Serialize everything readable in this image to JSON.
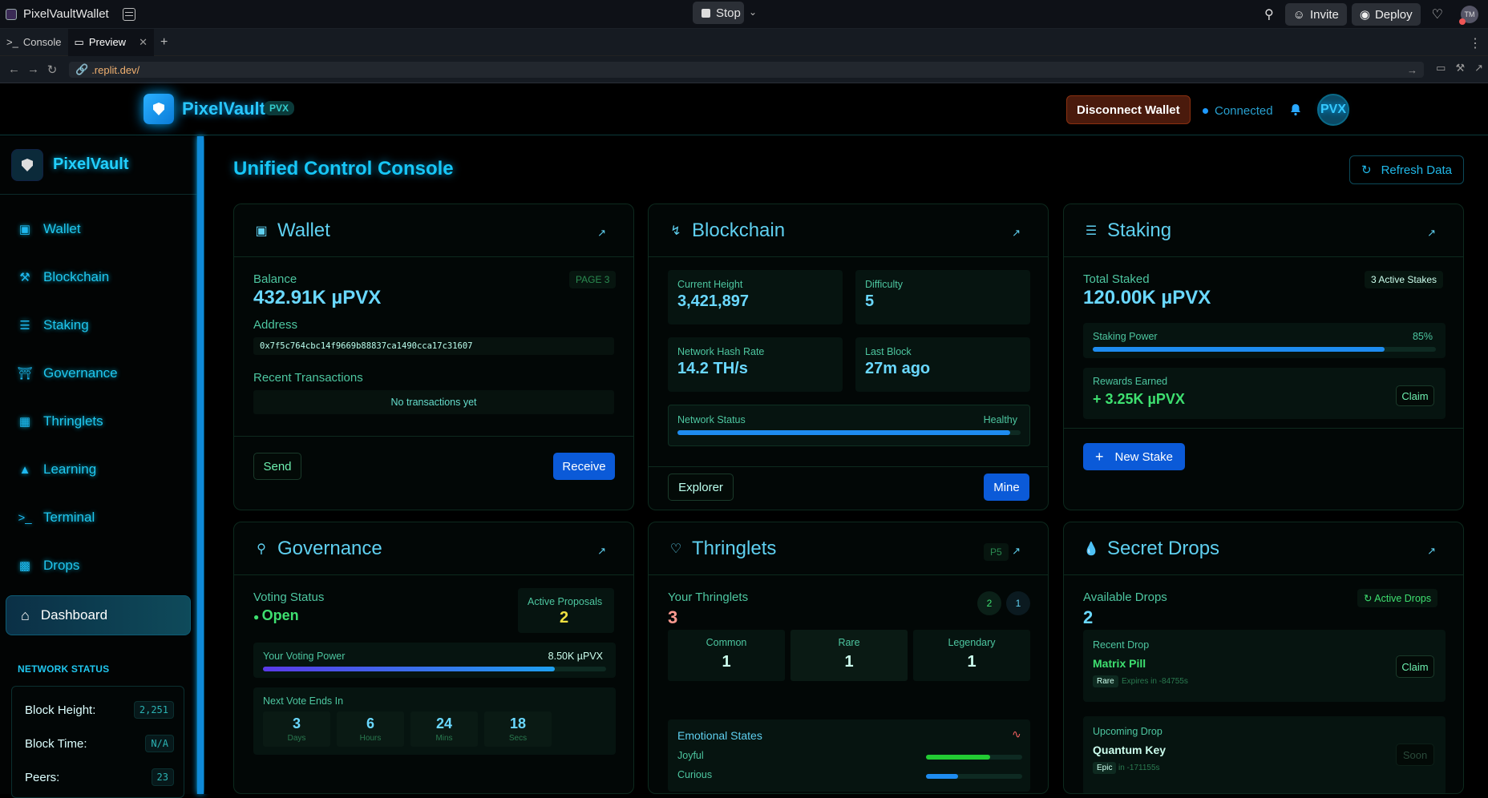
{
  "ide": {
    "app_name": "PixelVaultWallet",
    "stop_label": "Stop",
    "invite_label": "Invite",
    "deploy_label": "Deploy",
    "avatar_initials": "TM",
    "tabs": [
      {
        "label": "Console"
      },
      {
        "label": "Preview"
      }
    ],
    "url": ".replit.dev/"
  },
  "header": {
    "brand": "PixelVault",
    "tag": "PVX",
    "disconnect_label": "Disconnect  Wallet",
    "status": "Connected",
    "avatar": "PVX"
  },
  "sidebar": {
    "brand": "PixelVault",
    "items": [
      {
        "label": "Wallet",
        "icon": "wallet-icon"
      },
      {
        "label": "Blockchain",
        "icon": "hammer-icon"
      },
      {
        "label": "Staking",
        "icon": "layers-icon"
      },
      {
        "label": "Governance",
        "icon": "bank-icon"
      },
      {
        "label": "Thringlets",
        "icon": "image-icon"
      },
      {
        "label": "Learning",
        "icon": "graduation-cap-icon"
      },
      {
        "label": "Terminal",
        "icon": "terminal-icon"
      },
      {
        "label": "Drops",
        "icon": "gift-icon"
      }
    ],
    "dashboard": "Dashboard",
    "network_status_title": "NETWORK STATUS",
    "network": [
      {
        "label": "Block Height:",
        "value": "2,251"
      },
      {
        "label": "Block Time:",
        "value": "N/A"
      },
      {
        "label": "Peers:",
        "value": "23"
      }
    ]
  },
  "main": {
    "title": "Unified Control Console",
    "refresh_label": "Refresh Data",
    "wallet": {
      "title": "Wallet",
      "balance_label": "Balance",
      "page_tag": "PAGE 3",
      "balance": "432.91K µPVX",
      "address_label": "Address",
      "address": "0x7f5c764cbc14f9669b88837ca1490cca17c31607",
      "recent_label": "Recent Transactions",
      "empty": "No transactions yet",
      "send": "Send",
      "receive": "Receive"
    },
    "blockchain": {
      "title": "Blockchain",
      "height_label": "Current Height",
      "height": "3,421,897",
      "difficulty_label": "Difficulty",
      "difficulty": "5",
      "hashrate_label": "Network Hash Rate",
      "hashrate": "14.2 TH/s",
      "lastblock_label": "Last Block",
      "lastblock": "27m ago",
      "status_label": "Network Status",
      "status": "Healthy",
      "status_pct": 0.97,
      "explorer": "Explorer",
      "mine": "Mine"
    },
    "staking": {
      "title": "Staking",
      "total_label": "Total Staked",
      "active_tag": "3 Active Stakes",
      "total": "120.00K µPVX",
      "power_label": "Staking Power",
      "power_pct": "85%",
      "power_value": 0.85,
      "rewards_label": "Rewards Earned",
      "rewards": "+ 3.25K µPVX",
      "claim": "Claim",
      "new_stake": "New Stake"
    },
    "governance": {
      "title": "Governance",
      "voting_label": "Voting Status",
      "voting": "Open",
      "proposals_label": "Active Proposals",
      "proposals": "2",
      "power_label": "Your Voting Power",
      "power": "8.50K µPVX",
      "power_value": 0.85,
      "ends_label": "Next Vote Ends In",
      "countdown": [
        {
          "value": "3",
          "unit": "Days"
        },
        {
          "value": "6",
          "unit": "Hours"
        },
        {
          "value": "24",
          "unit": "Mins"
        },
        {
          "value": "18",
          "unit": "Secs"
        }
      ]
    },
    "thringlets": {
      "title": "Thringlets",
      "tag": "P5",
      "yours_label": "Your Thringlets",
      "yours": "3",
      "badges": [
        "2",
        "1"
      ],
      "rarity": [
        {
          "label": "Common",
          "value": "1"
        },
        {
          "label": "Rare",
          "value": "1"
        },
        {
          "label": "Legendary",
          "value": "1"
        }
      ],
      "emotions_label": "Emotional States",
      "emotions": [
        {
          "label": "Joyful",
          "value": 0.67,
          "color": "#22cc33"
        },
        {
          "label": "Curious",
          "value": 0.33,
          "color": "#1e8cf0"
        }
      ]
    },
    "drops": {
      "title": "Secret Drops",
      "available_label": "Available Drops",
      "available": "2",
      "active_tag": "Active Drops",
      "recent_label": "Recent Drop",
      "recent_name": "Matrix Pill",
      "recent_rarity": "Rare",
      "recent_expiry": "Expires in -84755s",
      "claim": "Claim",
      "upcoming_label": "Upcoming Drop",
      "upcoming_name": "Quantum Key",
      "upcoming_rarity": "Epic",
      "upcoming_expiry": "in -171155s",
      "soon": "Soon"
    }
  }
}
